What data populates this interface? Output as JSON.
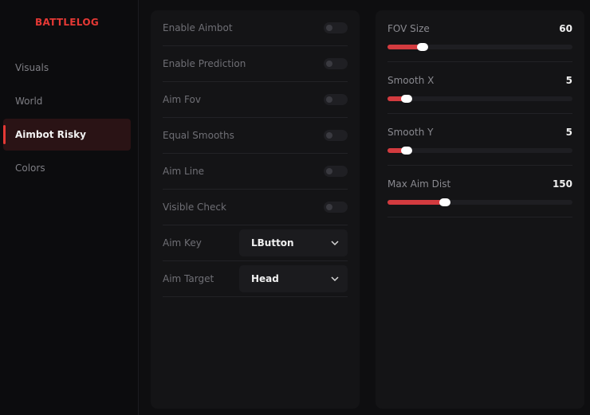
{
  "brand": "BATTLELOG",
  "nav": [
    {
      "label": "Visuals",
      "active": false
    },
    {
      "label": "World",
      "active": false
    },
    {
      "label": "Aimbot Risky",
      "active": true
    },
    {
      "label": "Colors",
      "active": false
    }
  ],
  "accent_color": "#e53935",
  "toggles": [
    {
      "label": "Enable Aimbot",
      "on": false
    },
    {
      "label": "Enable Prediction",
      "on": false
    },
    {
      "label": "Aim Fov",
      "on": false
    },
    {
      "label": "Equal Smooths",
      "on": false
    },
    {
      "label": "Aim Line",
      "on": false
    },
    {
      "label": "Visible Check",
      "on": false
    }
  ],
  "selects": [
    {
      "label": "Aim Key",
      "value": "LButton"
    },
    {
      "label": "Aim Target",
      "value": "Head"
    }
  ],
  "sliders": [
    {
      "label": "FOV Size",
      "value": "60",
      "fraction": 0.19
    },
    {
      "label": "Smooth X",
      "value": "5",
      "fraction": 0.105
    },
    {
      "label": "Smooth Y",
      "value": "5",
      "fraction": 0.105
    },
    {
      "label": "Max Aim Dist",
      "value": "150",
      "fraction": 0.31
    }
  ]
}
